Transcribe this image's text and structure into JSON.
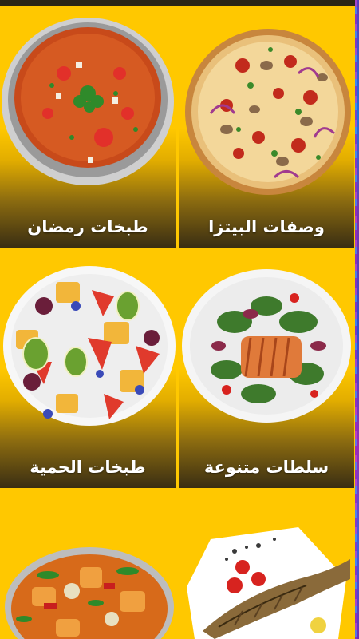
{
  "colors": {
    "background": "#ffc800",
    "caption_text": "#ffffff",
    "card_gradient_bottom": "#3a2e12"
  },
  "categories": [
    {
      "title": "وصفات البيتزا",
      "image": "pizza-image"
    },
    {
      "title": "طبخات رمضان",
      "image": "soup-bowl-image"
    },
    {
      "title": "سلطات متنوعة",
      "image": "salmon-salad-image"
    },
    {
      "title": "طبخات الحمية",
      "image": "fruit-salad-image"
    },
    {
      "title": "",
      "image": "grilled-fish-plate-image"
    },
    {
      "title": "",
      "image": "vegetable-curry-image"
    }
  ]
}
